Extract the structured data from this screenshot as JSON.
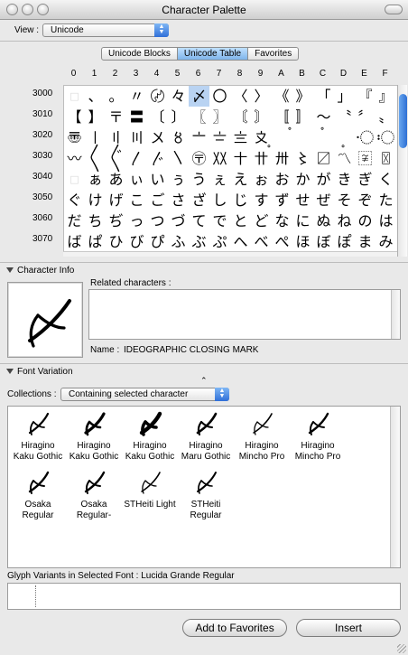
{
  "window": {
    "title": "Character Palette"
  },
  "view": {
    "label": "View :",
    "value": "Unicode"
  },
  "tabs": [
    {
      "label": "Unicode Blocks",
      "active": false
    },
    {
      "label": "Unicode Table",
      "active": true
    },
    {
      "label": "Favorites",
      "active": false
    }
  ],
  "table": {
    "columns": [
      "0",
      "1",
      "2",
      "3",
      "4",
      "5",
      "6",
      "7",
      "8",
      "9",
      "A",
      "B",
      "C",
      "D",
      "E",
      "F"
    ],
    "rows": [
      {
        "code": "3000",
        "chars": [
          "",
          "、",
          "。",
          "〃",
          "〄",
          "々",
          "〆",
          "〇",
          "〈",
          "〉",
          "《",
          "》",
          "「",
          "」",
          "『",
          "』"
        ]
      },
      {
        "code": "3010",
        "chars": [
          "【",
          "】",
          "〒",
          "〓",
          "〔",
          "〕",
          "〖",
          "〗",
          "〘",
          "〙",
          "〚",
          "〛",
          "〜",
          "〝",
          "〞",
          "〟"
        ]
      },
      {
        "code": "3020",
        "chars": [
          "〠",
          "〡",
          "〢",
          "〣",
          "〤",
          "〥",
          "〦",
          "〧",
          "〨",
          "〩",
          "〪",
          "〫",
          "〬",
          "〭",
          "〮",
          "〯"
        ]
      },
      {
        "code": "3030",
        "chars": [
          "〰",
          "〱",
          "〲",
          "〳",
          "〴",
          "〵",
          "〶",
          "〷",
          "〸",
          "〹",
          "〺",
          "〻",
          "〼",
          "〽",
          "〾",
          "〿"
        ]
      },
      {
        "code": "3040",
        "chars": [
          "",
          "ぁ",
          "あ",
          "ぃ",
          "い",
          "ぅ",
          "う",
          "ぇ",
          "え",
          "ぉ",
          "お",
          "か",
          "が",
          "き",
          "ぎ",
          "く"
        ]
      },
      {
        "code": "3050",
        "chars": [
          "ぐ",
          "け",
          "げ",
          "こ",
          "ご",
          "さ",
          "ざ",
          "し",
          "じ",
          "す",
          "ず",
          "せ",
          "ぜ",
          "そ",
          "ぞ",
          "た"
        ]
      },
      {
        "code": "3060",
        "chars": [
          "だ",
          "ち",
          "ぢ",
          "っ",
          "つ",
          "づ",
          "て",
          "で",
          "と",
          "ど",
          "な",
          "に",
          "ぬ",
          "ね",
          "の",
          "は"
        ]
      },
      {
        "code": "3070",
        "chars": [
          "ば",
          "ぱ",
          "ひ",
          "び",
          "ぴ",
          "ふ",
          "ぶ",
          "ぷ",
          "へ",
          "べ",
          "ぺ",
          "ほ",
          "ぼ",
          "ぽ",
          "ま",
          "み"
        ]
      }
    ],
    "selected_row": 0,
    "selected_col": 6
  },
  "character_info": {
    "header": "Character Info",
    "related_label": "Related characters :",
    "name_label": "Name :",
    "name_value": "IDEOGRAPHIC CLOSING MARK"
  },
  "font_variation": {
    "header": "Font Variation",
    "collections_label": "Collections :",
    "collections_value": "Containing selected character",
    "fonts": [
      {
        "line1": "Hiragino",
        "line2": "Kaku Gothic",
        "weight": 2.2
      },
      {
        "line1": "Hiragino",
        "line2": "Kaku Gothic",
        "weight": 3.2
      },
      {
        "line1": "Hiragino",
        "line2": "Kaku Gothic",
        "weight": 4.4
      },
      {
        "line1": "Hiragino",
        "line2": "Maru Gothic",
        "weight": 2.6
      },
      {
        "line1": "Hiragino",
        "line2": "Mincho Pro",
        "weight": 1.6
      },
      {
        "line1": "Hiragino",
        "line2": "Mincho Pro",
        "weight": 2.4
      },
      {
        "line1": "Osaka",
        "line2": "Regular",
        "weight": 2.4
      },
      {
        "line1": "Osaka",
        "line2": "Regular-",
        "weight": 2.4
      },
      {
        "line1": "STHeiti Light",
        "line2": "",
        "weight": 1.6
      },
      {
        "line1": "STHeiti",
        "line2": "Regular",
        "weight": 2.0
      }
    ]
  },
  "glyph_variants": {
    "label": "Glyph Variants in Selected Font : Lucida Grande Regular"
  },
  "buttons": {
    "add_favorites": "Add to Favorites",
    "insert": "Insert"
  }
}
